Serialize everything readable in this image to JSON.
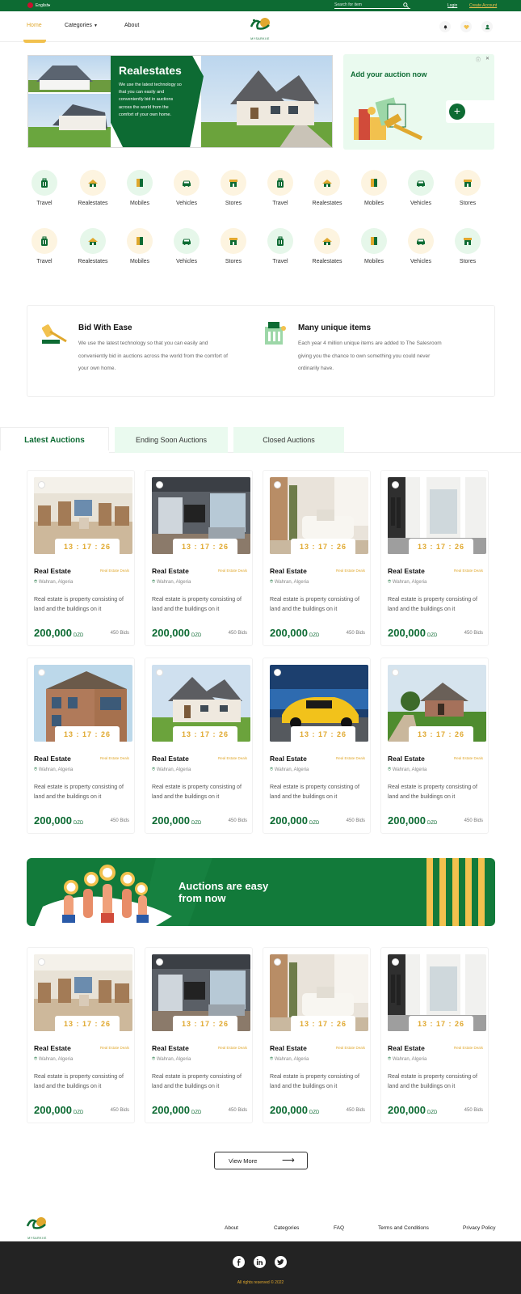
{
  "topbar": {
    "language": "English",
    "search_placeholder": "Search for item",
    "login": "Login",
    "create_account": "Create Account"
  },
  "header": {
    "nav": [
      "Home",
      "Categories",
      "About"
    ],
    "logo_text": "MYSARKIIE"
  },
  "hero": {
    "title": "Realestates",
    "text": "We use the latest technology so that you can easily and conveniently bid in auctions across the world from the comfort of your own home.",
    "ad_title": "Add your auction now"
  },
  "categories": {
    "row1": [
      "Travel",
      "Realestates",
      "Mobiles",
      "Vehicles",
      "Stores",
      "Travel",
      "Realestates",
      "Mobiles",
      "Vehicles",
      "Stores"
    ],
    "row2": [
      "Travel",
      "Realestates",
      "Mobiles",
      "Vehicles",
      "Stores",
      "Travel",
      "Realestates",
      "Mobiles",
      "Vehicles",
      "Stores"
    ]
  },
  "features": [
    {
      "title": "Bid With Ease",
      "text": "We use the latest technology so that you can easily and conveniently bid in auctions across the world from the comfort of your own home."
    },
    {
      "title": "Many unique items",
      "text": "Each year 4 million unique items are added to The Salesroom giving you the chance to own something you could never ordinarily have."
    }
  ],
  "tabs": [
    "Latest Auctions",
    "Ending Soon Auctions",
    "Closed Auctions"
  ],
  "card": {
    "timer": "13 : 17 : 26",
    "title": "Real Estate",
    "tag": "Real Estate Deals",
    "location": "Wahran, Algeria",
    "desc": "Real estate is property consisting of land and the buildings on it",
    "price": "200,000",
    "currency": "DZD",
    "bids": "450 Bids"
  },
  "banner": {
    "title": "Auctions are easy from now"
  },
  "view_more": "View More",
  "footer": {
    "links": [
      "About",
      "Categories",
      "FAQ",
      "Terms and Conditions",
      "Privacy Policy"
    ],
    "copyright": "All rights reserved © 2022"
  },
  "colors": {
    "brand_green": "#0d6b33",
    "accent_yellow": "#e0a82e",
    "light_green": "#e6f7ea"
  }
}
